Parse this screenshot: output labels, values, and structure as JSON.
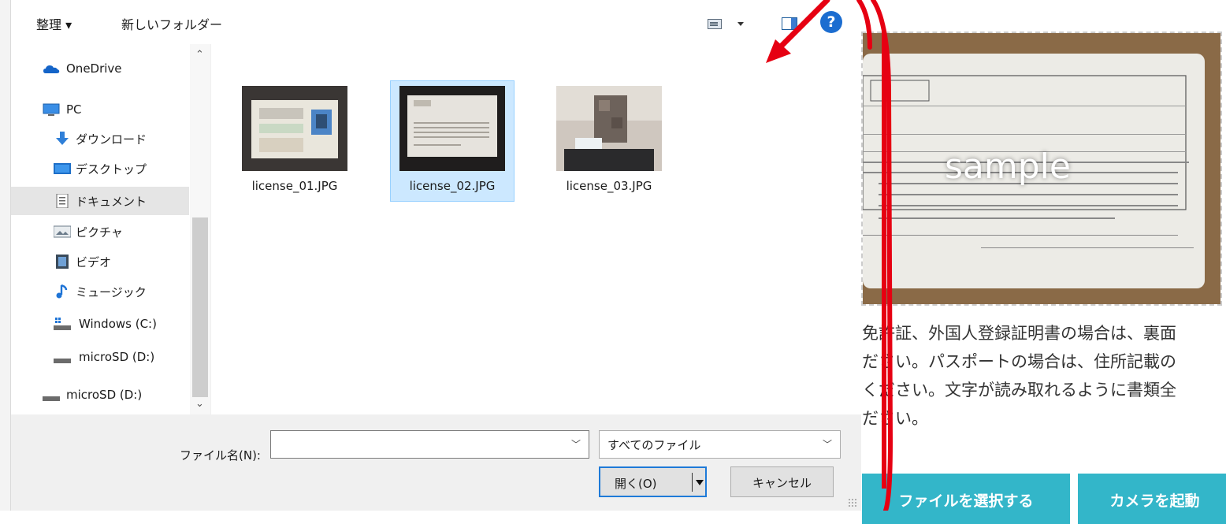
{
  "dialog": {
    "toolbar": {
      "organize": "整理 ▾",
      "new_folder": "新しいフォルダー"
    },
    "nav_items": [
      {
        "label": "OneDrive",
        "icon": "cloud-icon"
      },
      {
        "label": "PC",
        "icon": "pc-icon"
      },
      {
        "label": "ダウンロード",
        "icon": "download-arrow-icon"
      },
      {
        "label": "デスクトップ",
        "icon": "desktop-icon"
      },
      {
        "label": "ドキュメント",
        "icon": "document-icon",
        "selected": true
      },
      {
        "label": "ピクチャ",
        "icon": "pictures-icon"
      },
      {
        "label": "ビデオ",
        "icon": "video-icon"
      },
      {
        "label": "ミュージック",
        "icon": "music-note-icon"
      },
      {
        "label": "Windows (C:)",
        "icon": "drive-c-icon"
      },
      {
        "label": "microSD (D:)",
        "icon": "drive-icon"
      },
      {
        "label": "microSD (D:)",
        "icon": "drive-icon"
      }
    ],
    "files": [
      {
        "name": "license_01.JPG"
      },
      {
        "name": "license_02.JPG",
        "selected": true
      },
      {
        "name": "license_03.JPG"
      }
    ],
    "filename_label": "ファイル名(N):",
    "filename_value": "",
    "filetype_value": "すべてのファイル",
    "open_label": "開く(O)",
    "cancel_label": "キャンセル"
  },
  "page": {
    "sample_watermark": "sample",
    "instruction_lines": [
      "免許証、外国人登録証明書の場合は、裏面",
      "ださい。パスポートの場合は、住所記載の",
      "ください。文字が読み取れるように書類全",
      "ださい。"
    ],
    "select_file_button": "ファイルを選択する",
    "camera_button": "カメラを起動"
  },
  "colors": {
    "cta": "#33b6c9",
    "annotation": "#e60012",
    "selection": "#cce8ff"
  }
}
